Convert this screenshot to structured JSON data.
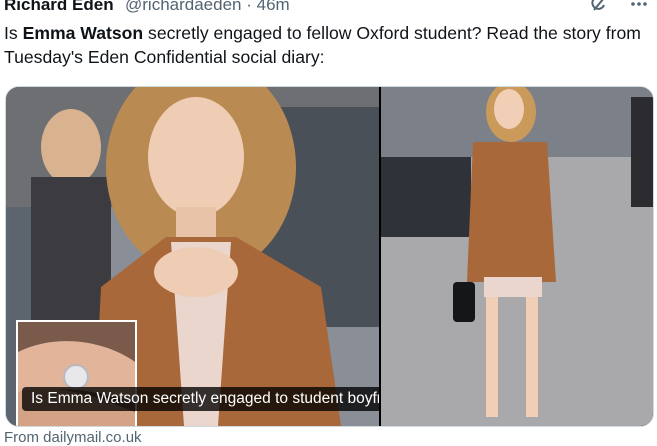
{
  "tweet": {
    "author_name": "Richard Eden",
    "handle": "@richardaeden",
    "separator": "·",
    "time": "46m",
    "text_part1": "Is ",
    "text_bold": "Emma Watson",
    "text_part2": " secretly engaged to fellow Oxford student? Read the story from Tuesday's Eden Confidential social diary:",
    "icons": [
      "grok-icon",
      "more-options-icon"
    ]
  },
  "card": {
    "caption": "Is Emma Watson secretly engaged to student boyfriend Kieran Brown?",
    "source": "From dailymail.co.uk"
  },
  "colors": {
    "text": "#0f1419",
    "secondary": "#536471",
    "border": "#cfd9de",
    "jacket": "#a8683a"
  }
}
